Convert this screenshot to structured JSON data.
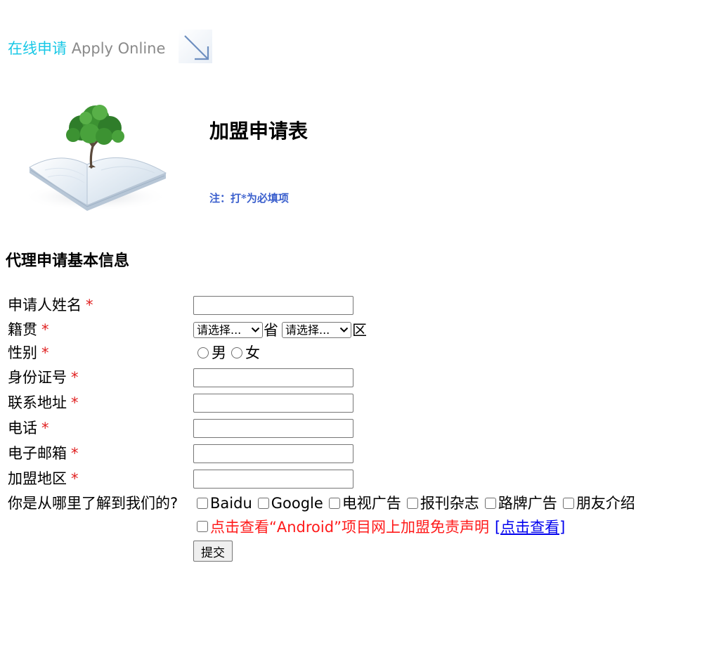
{
  "header": {
    "title_cn": "在线申请",
    "title_en": "Apply Online",
    "arrow_icon": "diagonal-arrow-icon",
    "accent_color": "#19c8e6"
  },
  "hero": {
    "image_icon": "book-tree-icon",
    "form_title": "加盟申请表",
    "required_note": "注：打*为必填项"
  },
  "section": {
    "title": "代理申请基本信息"
  },
  "form": {
    "required_mark": "*",
    "fields": {
      "name": {
        "label": "申请人姓名",
        "value": ""
      },
      "origin": {
        "label": "籍贯",
        "province_select": "请选择...",
        "province_unit": "省",
        "district_select": "请选择...",
        "district_unit": "区"
      },
      "gender": {
        "label": "性别",
        "options": [
          "男",
          "女"
        ]
      },
      "id_number": {
        "label": "身份证号",
        "value": ""
      },
      "address": {
        "label": "联系地址",
        "value": ""
      },
      "phone": {
        "label": "电话",
        "value": ""
      },
      "email": {
        "label": "电子邮箱",
        "value": ""
      },
      "region": {
        "label": "加盟地区",
        "value": ""
      }
    },
    "source": {
      "label": "你是从哪里了解到我们的?",
      "options": [
        "Baidu",
        "Google",
        "电视广告",
        "报刊杂志",
        "路牌广告",
        "朋友介绍"
      ]
    },
    "disclaimer": {
      "text": "点击查看“Android”项目网上加盟免责声明",
      "link": "[点击查看]"
    },
    "submit_label": "提交"
  }
}
